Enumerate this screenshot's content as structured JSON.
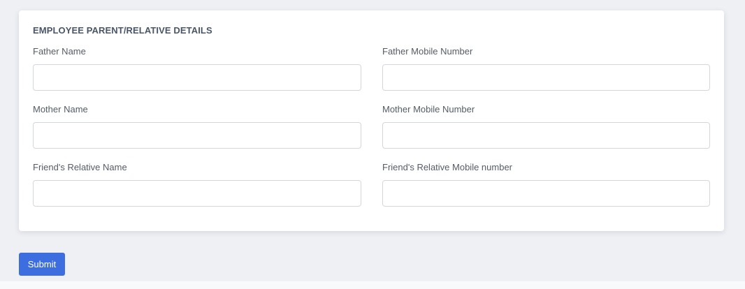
{
  "section": {
    "title": "EMPLOYEE PARENT/RELATIVE DETAILS"
  },
  "fields": {
    "father_name": {
      "label": "Father Name",
      "value": ""
    },
    "father_mobile": {
      "label": "Father Mobile Number",
      "value": ""
    },
    "mother_name": {
      "label": "Mother Name",
      "value": ""
    },
    "mother_mobile": {
      "label": "Mother Mobile Number",
      "value": ""
    },
    "friend_relative_name": {
      "label": "Friend's Relative Name",
      "value": ""
    },
    "friend_relative_mobile": {
      "label": "Friend's Relative Mobile number",
      "value": ""
    }
  },
  "actions": {
    "submit_label": "Submit"
  },
  "colors": {
    "page_background": "#eef0f4",
    "card_background": "#ffffff",
    "submit_button": "#3d6ee0",
    "title_text": "#4a5568",
    "input_border": "#d3d7dd"
  }
}
